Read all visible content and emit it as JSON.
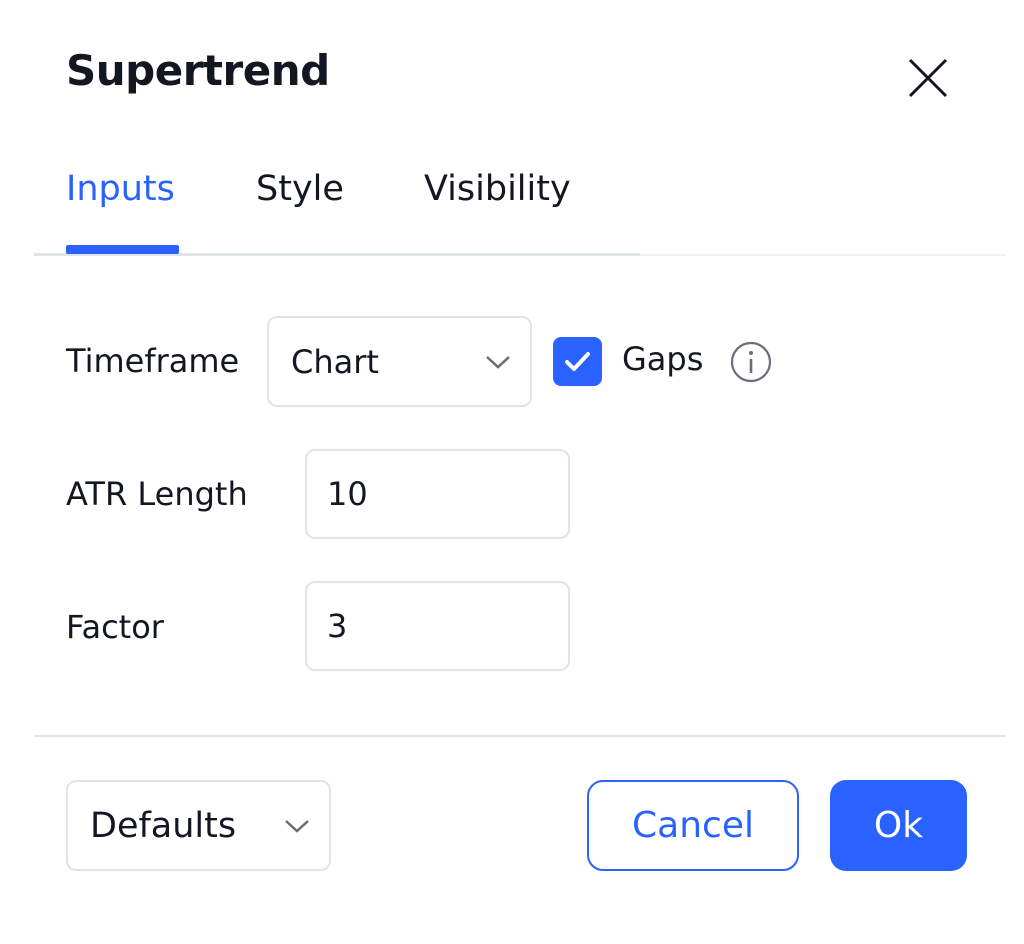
{
  "dialog": {
    "title": "Supertrend",
    "close_icon": "close-icon"
  },
  "tabs": [
    {
      "label": "Inputs",
      "active": true
    },
    {
      "label": "Style",
      "active": false
    },
    {
      "label": "Visibility",
      "active": false
    }
  ],
  "inputs": {
    "timeframe": {
      "label": "Timeframe",
      "value": "Chart",
      "icon": "chevron-down-icon"
    },
    "gaps": {
      "label": "Gaps",
      "checked": true,
      "icon": "info-icon"
    },
    "atr_length": {
      "label": "ATR Length",
      "value": "10"
    },
    "factor": {
      "label": "Factor",
      "value": "3"
    }
  },
  "footer": {
    "defaults_label": "Defaults",
    "cancel_label": "Cancel",
    "ok_label": "Ok"
  },
  "colors": {
    "accent": "#2962ff",
    "text": "#131722",
    "border": "#e0e3eb"
  }
}
